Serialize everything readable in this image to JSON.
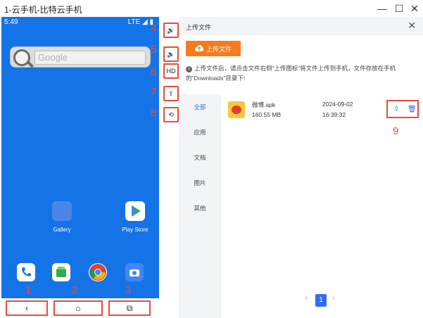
{
  "window": {
    "title": "1-云手机-比特云手机",
    "min": "—",
    "max": "☐",
    "close": "✕"
  },
  "phone": {
    "time": "5:49",
    "network": "LTE ◢ ▮",
    "search_placeholder": "Google",
    "apps": [
      {
        "label": "Gallery"
      },
      {
        "label": "Play Store"
      }
    ],
    "nav": {
      "back": "‹",
      "home": "⌂",
      "recents": "⧉"
    },
    "nav_labels": [
      "1",
      "2",
      "3"
    ]
  },
  "toolbar": {
    "buttons": [
      {
        "icon": "volume-up-icon",
        "glyph": "🔊",
        "label": "4"
      },
      {
        "icon": "volume-down-icon",
        "glyph": "🔉",
        "label": "5"
      },
      {
        "icon": "hd-icon",
        "glyph": "HD",
        "label": "6"
      },
      {
        "icon": "upload-file-icon",
        "glyph": "⇪",
        "label": "7"
      },
      {
        "icon": "restore-icon",
        "glyph": "⟲",
        "label": "8"
      }
    ]
  },
  "panel": {
    "title": "上传文件",
    "close": "✕",
    "upload_button": "上传文件",
    "hint_icon": "i",
    "hint": "上传文件后，请点击文件右侧“上传图标”将文件上传到手机，文件存放在手机的“Downloads”目录下!",
    "categories": [
      "全部",
      "应用",
      "文档",
      "图片",
      "其他"
    ],
    "active_category": "全部",
    "files": [
      {
        "name": "微博.apk",
        "size": "160.55 MB",
        "date": "2024-09-02",
        "time": "16:39:32"
      }
    ],
    "row_label": "9",
    "actions": {
      "upload": "⇪",
      "delete": "🗑"
    },
    "pagination": {
      "prev": "‹",
      "current": "1",
      "next": "›"
    }
  }
}
